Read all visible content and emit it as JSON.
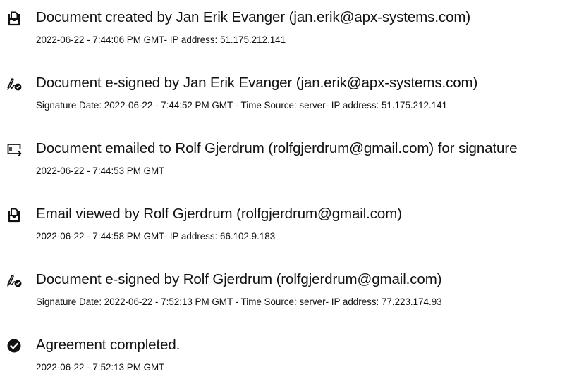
{
  "events": [
    {
      "icon": "document-created-icon",
      "title": "Document created by Jan Erik Evanger (jan.erik@apx-systems.com)",
      "meta": "2022-06-22 - 7:44:06 PM GMT- IP address: 51.175.212.141"
    },
    {
      "icon": "e-signature-icon",
      "title": "Document e-signed by Jan Erik Evanger (jan.erik@apx-systems.com)",
      "meta": "Signature Date: 2022-06-22 - 7:44:52 PM GMT - Time Source: server- IP address: 51.175.212.141"
    },
    {
      "icon": "email-sent-icon",
      "title": "Document emailed to Rolf Gjerdrum (rolfgjerdrum@gmail.com) for signature",
      "meta": "2022-06-22 - 7:44:53 PM GMT"
    },
    {
      "icon": "email-viewed-icon",
      "title": "Email viewed by Rolf Gjerdrum (rolfgjerdrum@gmail.com)",
      "meta": "2022-06-22 - 7:44:58 PM GMT- IP address: 66.102.9.183"
    },
    {
      "icon": "e-signature-icon",
      "title": "Document e-signed by Rolf Gjerdrum (rolfgjerdrum@gmail.com)",
      "meta": "Signature Date: 2022-06-22 - 7:52:13 PM GMT - Time Source: server- IP address: 77.223.174.93"
    },
    {
      "icon": "agreement-completed-icon",
      "title": "Agreement completed.",
      "meta": "2022-06-22 - 7:52:13 PM GMT"
    }
  ]
}
